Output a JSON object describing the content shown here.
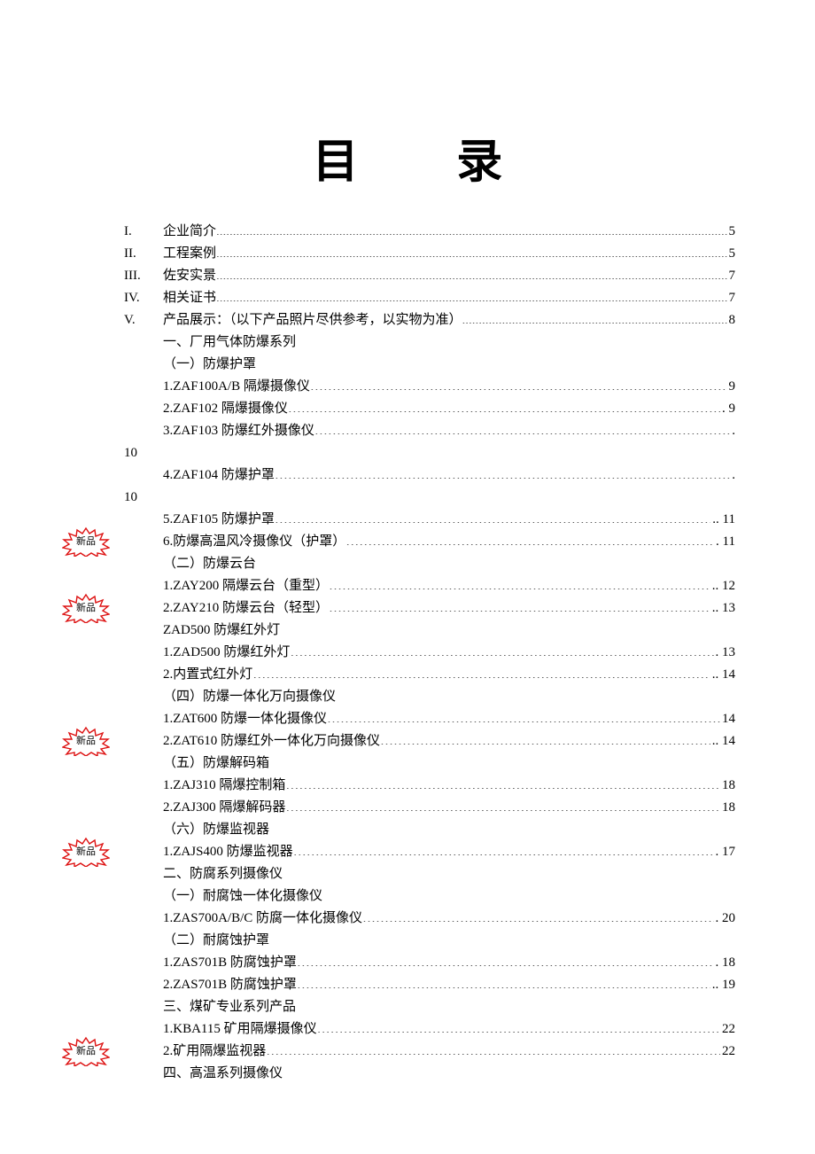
{
  "title": "目 录",
  "badge_text": "新品",
  "entries": [
    {
      "num": "I.",
      "label": "企业简介",
      "page": "5",
      "leader": "en"
    },
    {
      "num": "II.",
      "label": "工程案例",
      "page": "5",
      "leader": "en"
    },
    {
      "num": "III.",
      "label": "佐安实景",
      "page": "7",
      "leader": "en"
    },
    {
      "num": "IV.",
      "label": "相关证书",
      "page": "7",
      "leader": "en"
    },
    {
      "num": "V.",
      "label": "产品展示：（以下产品照片尽供参考，以实物为准）",
      "page": "8",
      "leader": "en"
    },
    {
      "num": "",
      "label": "一、厂用气体防爆系列",
      "page": "",
      "leader": ""
    },
    {
      "num": "",
      "label": "（一）防爆护罩",
      "page": "",
      "leader": ""
    },
    {
      "num": "",
      "label": "1.ZAF100A/B 隔爆摄像仪",
      "page": "9",
      "leader": "cn"
    },
    {
      "num": "",
      "label": "2.ZAF102 隔爆摄像仪",
      "page": "9",
      "leader": "cn",
      "trail": "."
    },
    {
      "num": "",
      "label": "3.ZAF103 防爆红外摄像仪",
      "page": "",
      "leader": "cn",
      "trail": ".",
      "wrap_page": "10"
    },
    {
      "num": "",
      "label": "4.ZAF104 防爆护罩",
      "page": "",
      "leader": "cn",
      "trail": ".",
      "wrap_page": "10"
    },
    {
      "num": "",
      "label": "5.ZAF105 防爆护罩",
      "page": "11",
      "leader": "cn",
      "trail": ".."
    },
    {
      "num": "",
      "label": "6.防爆高温风冷摄像仪（护罩）",
      "page": "11",
      "leader": "cn",
      "trail": ".",
      "badge": true
    },
    {
      "num": "",
      "label": "（二）防爆云台",
      "page": "",
      "leader": ""
    },
    {
      "num": "",
      "label": "1.ZAY200 隔爆云台（重型）",
      "page": "12",
      "leader": "cn",
      "trail": ".."
    },
    {
      "num": "",
      "label": "2.ZAY210 防爆云台（轻型）",
      "page": "13",
      "leader": "cn",
      "trail": "..",
      "badge": true
    },
    {
      "num": "",
      "label": "ZAD500 防爆红外灯",
      "page": "",
      "leader": ""
    },
    {
      "num": "",
      "label": "1.ZAD500 防爆红外灯",
      "page": "13",
      "leader": "cn",
      "trail": "."
    },
    {
      "num": "",
      "label": "2.内置式红外灯",
      "page": "14",
      "leader": "cn",
      "trail": ".."
    },
    {
      "num": "",
      "label": "（四）防爆一体化万向摄像仪",
      "page": "",
      "leader": ""
    },
    {
      "num": "",
      "label": "1.ZAT600 防爆一体化摄像仪",
      "page": "14",
      "leader": "cn"
    },
    {
      "num": "",
      "label": "2.ZAT610 防爆红外一体化万向摄像仪",
      "page": "14",
      "leader": "cn",
      "trail": "..",
      "badge": true
    },
    {
      "num": "",
      "label": "（五）防爆解码箱",
      "page": "",
      "leader": ""
    },
    {
      "num": "",
      "label": "1.ZAJ310 隔爆控制箱",
      "page": "18",
      "leader": "cn"
    },
    {
      "num": "",
      "label": "2.ZAJ300 隔爆解码器",
      "page": "18",
      "leader": "cn"
    },
    {
      "num": "",
      "label": "（六）防爆监视器",
      "page": "",
      "leader": ""
    },
    {
      "num": "",
      "label": "1.ZAJS400 防爆监视器",
      "page": "17",
      "leader": "cn",
      "trail": ".",
      "badge": true
    },
    {
      "num": "",
      "label": "二、防腐系列摄像仪",
      "page": "",
      "leader": ""
    },
    {
      "num": "",
      "label": "（一）耐腐蚀一体化摄像仪",
      "page": "",
      "leader": ""
    },
    {
      "num": "",
      "label": "1.ZAS700A/B/C 防腐一体化摄像仪",
      "page": "20",
      "leader": "cn",
      "trail": "."
    },
    {
      "num": "",
      "label": "（二）耐腐蚀护罩",
      "page": "",
      "leader": ""
    },
    {
      "num": "",
      "label": "1.ZAS701B 防腐蚀护罩",
      "page": "18",
      "leader": "cn",
      "trail": "."
    },
    {
      "num": "",
      "label": "2.ZAS701B 防腐蚀护罩",
      "page": "19",
      "leader": "cn",
      "trail": ".."
    },
    {
      "num": "",
      "label": "三、煤矿专业系列产品",
      "page": "",
      "leader": ""
    },
    {
      "num": "",
      "label": "1.KBA115 矿用隔爆摄像仪",
      "page": "22",
      "leader": "cn"
    },
    {
      "num": "",
      "label": "2.矿用隔爆监视器",
      "page": "22",
      "leader": "cn",
      "badge": true
    },
    {
      "num": "",
      "label": "四、高温系列摄像仪",
      "page": "",
      "leader": ""
    }
  ]
}
